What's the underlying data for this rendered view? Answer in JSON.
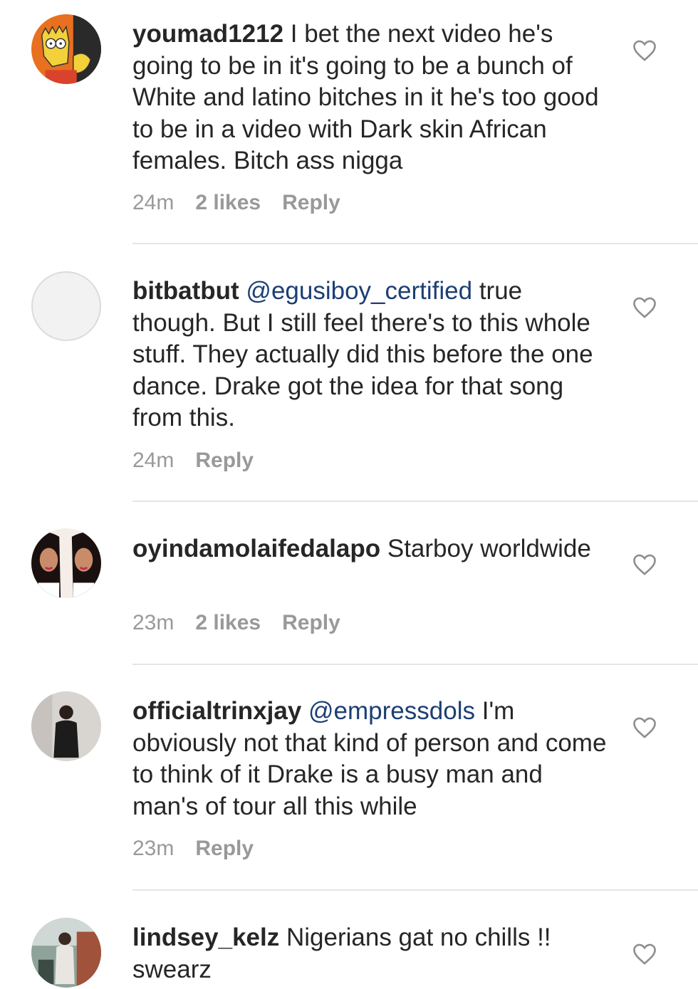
{
  "comments": [
    {
      "username": "youmad1212",
      "mention": "",
      "text": "I bet the next video he's going to be in it's going to be a bunch of White and latino bitches in it he's too good to be in a video with Dark skin African females. Bitch ass nigga",
      "time": "24m",
      "likes": "2 likes",
      "reply": "Reply",
      "avatar": "bart-simpson-avatar"
    },
    {
      "username": "bitbatbut",
      "mention": "@egusiboy_certified",
      "text": "true though. But I still feel there's to this whole stuff. They actually did this before the one dance. Drake got the idea for that song from this.",
      "time": "24m",
      "likes": "",
      "reply": "Reply",
      "avatar": "empty-avatar"
    },
    {
      "username": "oyindamolaifedalapo",
      "mention": "",
      "text": "Starboy worldwide",
      "time": "23m",
      "likes": "2 likes",
      "reply": "Reply",
      "avatar": "two-women-avatar"
    },
    {
      "username": "officialtrinxjay",
      "mention": "@empressdols",
      "text": "I'm obviously not that kind of person and come to think of it Drake is a busy man and man's of tour all this while",
      "time": "23m",
      "likes": "",
      "reply": "Reply",
      "avatar": "man-standing-avatar"
    },
    {
      "username": "lindsey_kelz",
      "mention": "",
      "text": "Nigerians gat no chills !! swearz",
      "time": "",
      "likes": "",
      "reply": "",
      "avatar": "person-outdoor-avatar"
    }
  ],
  "icons": {
    "like": "heart-outline-icon"
  },
  "colors": {
    "username": "#262626",
    "mention": "#1c3f73",
    "meta": "#999999",
    "divider": "#e5e5e5"
  }
}
